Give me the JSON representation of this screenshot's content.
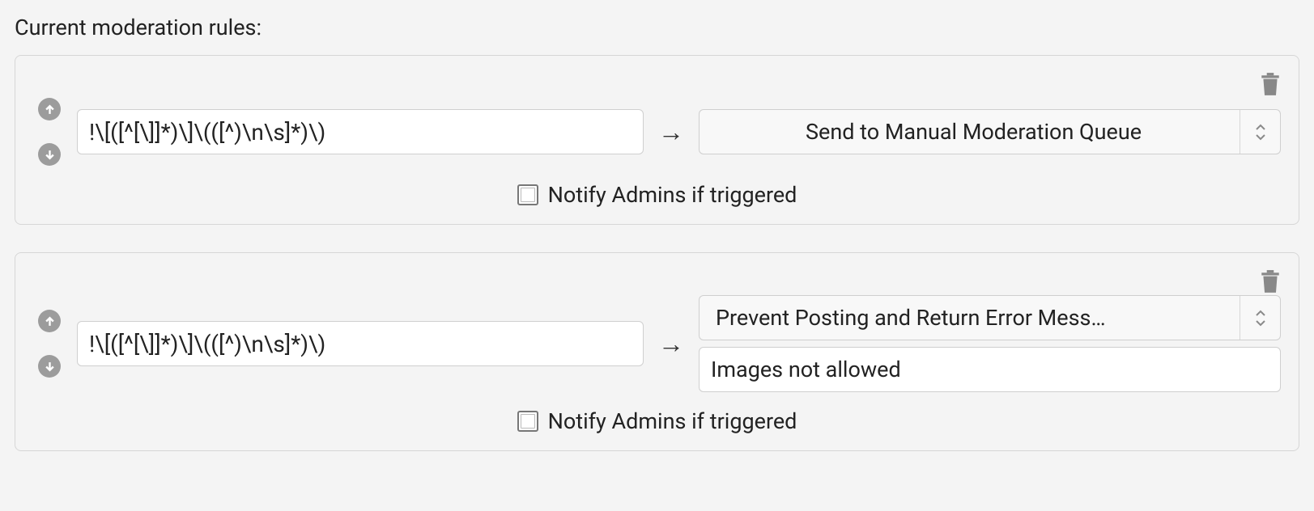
{
  "heading": "Current moderation rules:",
  "arrow": "→",
  "rules": [
    {
      "pattern": "!\\[([^[\\]]*)\\]\\(([^)\\n\\s]*)\\)",
      "action": "Send to Manual Moderation Queue",
      "has_message": false,
      "notify_label": "Notify Admins if triggered",
      "notify_checked": false
    },
    {
      "pattern": "!\\[([^[\\]]*)\\]\\(([^)\\n\\s]*)\\)",
      "action": "Prevent Posting and Return Error Mess…",
      "has_message": true,
      "message": "Images not allowed",
      "notify_label": "Notify Admins if triggered",
      "notify_checked": false
    }
  ]
}
